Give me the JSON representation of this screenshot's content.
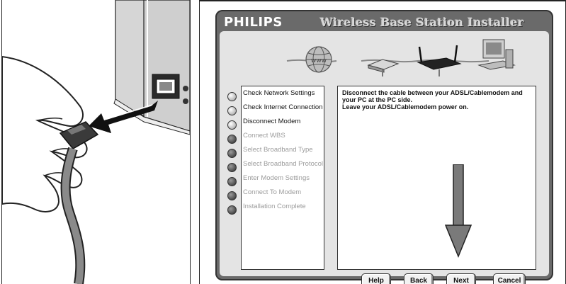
{
  "installer": {
    "logo": "PHILIPS",
    "title": "Wireless Base Station Installer",
    "steps": [
      {
        "label": "Check Network Settings",
        "state": "done"
      },
      {
        "label": "Check Internet Connection",
        "state": "done"
      },
      {
        "label": "Disconnect Modem",
        "state": "current"
      },
      {
        "label": "Connect WBS",
        "state": "todo"
      },
      {
        "label": "Select Broadband Type",
        "state": "todo"
      },
      {
        "label": "Select Broadband Protocol",
        "state": "todo"
      },
      {
        "label": "Enter Modem Settings",
        "state": "todo"
      },
      {
        "label": "Connect To Modem",
        "state": "todo"
      },
      {
        "label": "Installation Complete",
        "state": "todo"
      }
    ],
    "message_line1": "Disconnect the cable between your ADSL/Cablemodem and",
    "message_line2": "your PC at the PC side.",
    "message_line3": "Leave your ADSL/Cablemodem power on.",
    "buttons": {
      "help": "Help",
      "back": "Back",
      "next": "Next",
      "cancel": "Cancel"
    }
  },
  "illustration_icons": [
    "globe-icon",
    "modem-icon",
    "router-icon",
    "computer-icon"
  ],
  "left_illustration_icons": [
    "hand-icon",
    "ethernet-plug-icon",
    "ethernet-port-icon",
    "arrow-icon"
  ],
  "colors": {
    "window_frame": "#6a6a6a",
    "content_bg": "#e4e4e4",
    "step_done": "#c8c8c8",
    "step_todo": "#3a3a3a",
    "label_inactive": "#9c9c9c"
  }
}
